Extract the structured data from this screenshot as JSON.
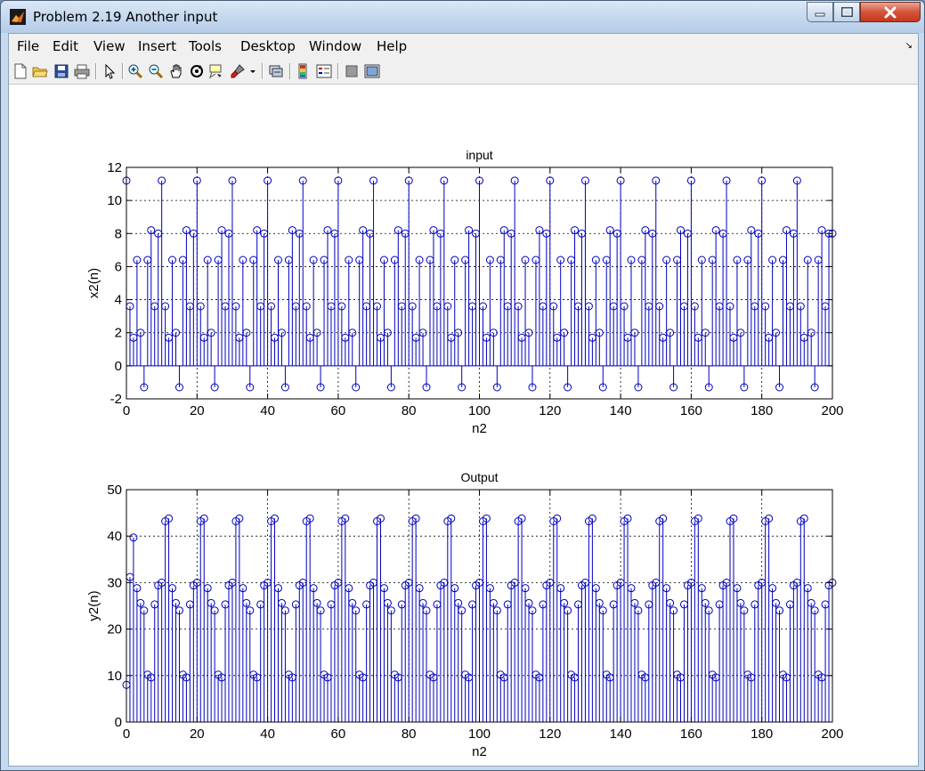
{
  "window": {
    "title": "Problem 2.19 Another input"
  },
  "menubar": {
    "items": [
      "File",
      "Edit",
      "View",
      "Insert",
      "Tools",
      "Desktop",
      "Window",
      "Help"
    ]
  },
  "toolbar": {
    "buttons": [
      "new-figure-icon",
      "open-file-icon",
      "save-icon",
      "print-icon",
      "edit-plot-arrow-icon",
      "zoom-in-icon",
      "zoom-out-icon",
      "pan-hand-icon",
      "rotate-3d-icon",
      "data-cursor-icon",
      "brush-icon",
      "brush-dropdown-icon",
      "link-plot-icon",
      "insert-colorbar-icon",
      "insert-legend-icon",
      "hide-plot-tools-icon",
      "show-plot-tools-icon"
    ]
  },
  "colors": {
    "stem": "#0000c0",
    "axes": "#000000"
  },
  "chart_data": [
    {
      "type": "stem",
      "title": "input",
      "xlabel": "n2",
      "ylabel": "x2(n)",
      "xlim": [
        0,
        200
      ],
      "ylim": [
        -2,
        12
      ],
      "xticks": [
        0,
        20,
        40,
        60,
        80,
        100,
        120,
        140,
        160,
        180,
        200
      ],
      "yticks": [
        -2,
        0,
        2,
        4,
        6,
        8,
        10,
        12
      ],
      "grid": true,
      "x_start": 0,
      "x_step": 1,
      "period": 10,
      "period_values": [
        11.2,
        3.6,
        1.7,
        6.4,
        2.0,
        -1.3,
        6.4,
        8.2,
        3.6,
        8.0
      ],
      "last_point": [
        200,
        8.0
      ]
    },
    {
      "type": "stem",
      "title": "Output",
      "xlabel": "n2",
      "ylabel": "y2(n)",
      "xlim": [
        0,
        200
      ],
      "ylim": [
        0,
        50
      ],
      "xticks": [
        0,
        20,
        40,
        60,
        80,
        100,
        120,
        140,
        160,
        180,
        200
      ],
      "yticks": [
        0,
        10,
        20,
        30,
        40,
        50
      ],
      "grid": true,
      "first_values": [
        8.0,
        31.2,
        39.7
      ],
      "x_start": 3,
      "x_step": 1,
      "period": 10,
      "period_values": [
        28.8,
        25.6,
        24.0,
        10.2,
        9.6,
        25.3,
        29.4,
        30.0,
        43.2,
        43.8,
        28.0,
        24.3,
        23.5,
        10.2,
        9.6,
        25.3,
        29.4,
        30.0
      ],
      "period_mode": "continue",
      "tail_pattern": [
        28.8,
        25.6,
        24.0,
        10.2,
        9.6,
        25.3,
        29.4,
        30.0,
        43.2,
        43.8
      ],
      "last_point": [
        200,
        30.0
      ]
    }
  ]
}
